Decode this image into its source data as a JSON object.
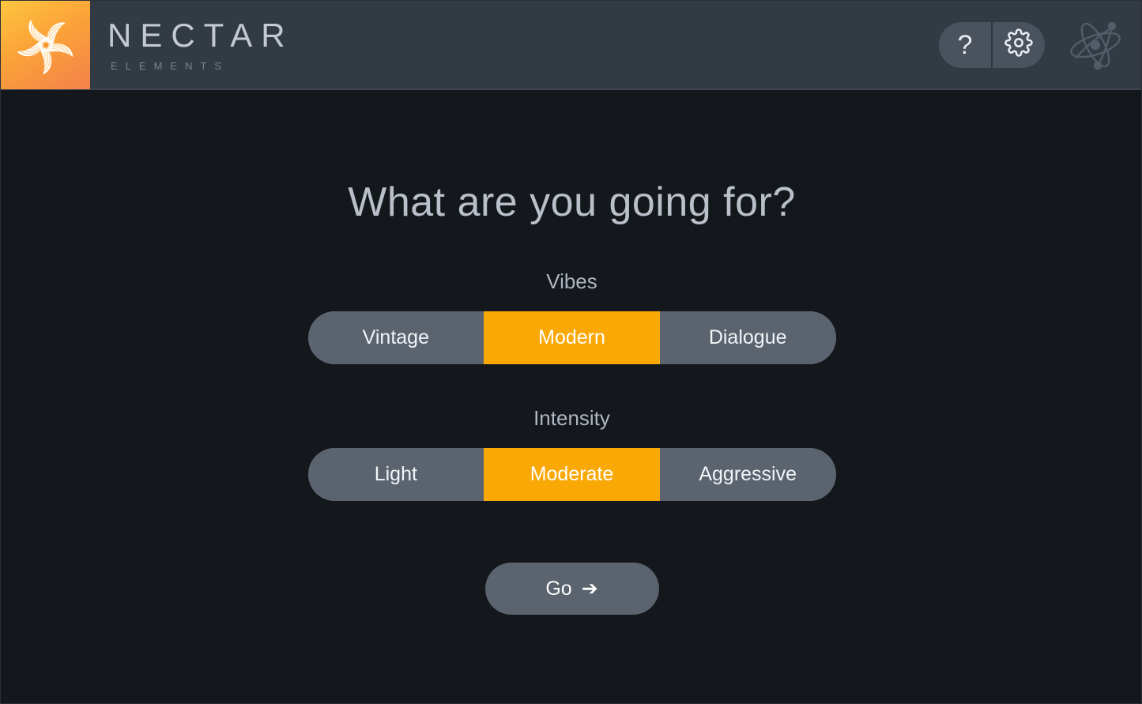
{
  "app": {
    "background_color": "#14171c",
    "accent_color": "#faa806"
  },
  "header": {
    "background_color": "#323a44",
    "logo": {
      "icon_name": "nectar-pinwheel-logo",
      "gradient_from": "#fdc63f",
      "gradient_to": "#f4814a"
    },
    "brand_title": "NECTAR",
    "brand_subtitle": "ELEMENTS",
    "actions": [
      {
        "icon_name": "help-question-icon",
        "glyph": "?"
      },
      {
        "icon_name": "gear-settings-icon",
        "glyph": "gear"
      }
    ],
    "decoration": {
      "icon_name": "atom-scribble-decoration"
    }
  },
  "main": {
    "title": "What are you going for?",
    "groups": [
      {
        "label": "Vibes",
        "name": "vibes",
        "options": [
          "Vintage",
          "Modern",
          "Dialogue"
        ],
        "selected_index": 1,
        "selected_value": "Modern"
      },
      {
        "label": "Intensity",
        "name": "intensity",
        "options": [
          "Light",
          "Moderate",
          "Aggressive"
        ],
        "selected_index": 1,
        "selected_value": "Moderate"
      }
    ],
    "go_button": {
      "label": "Go",
      "arrow_glyph": "➔",
      "icon_name": "arrow-right-icon"
    }
  }
}
